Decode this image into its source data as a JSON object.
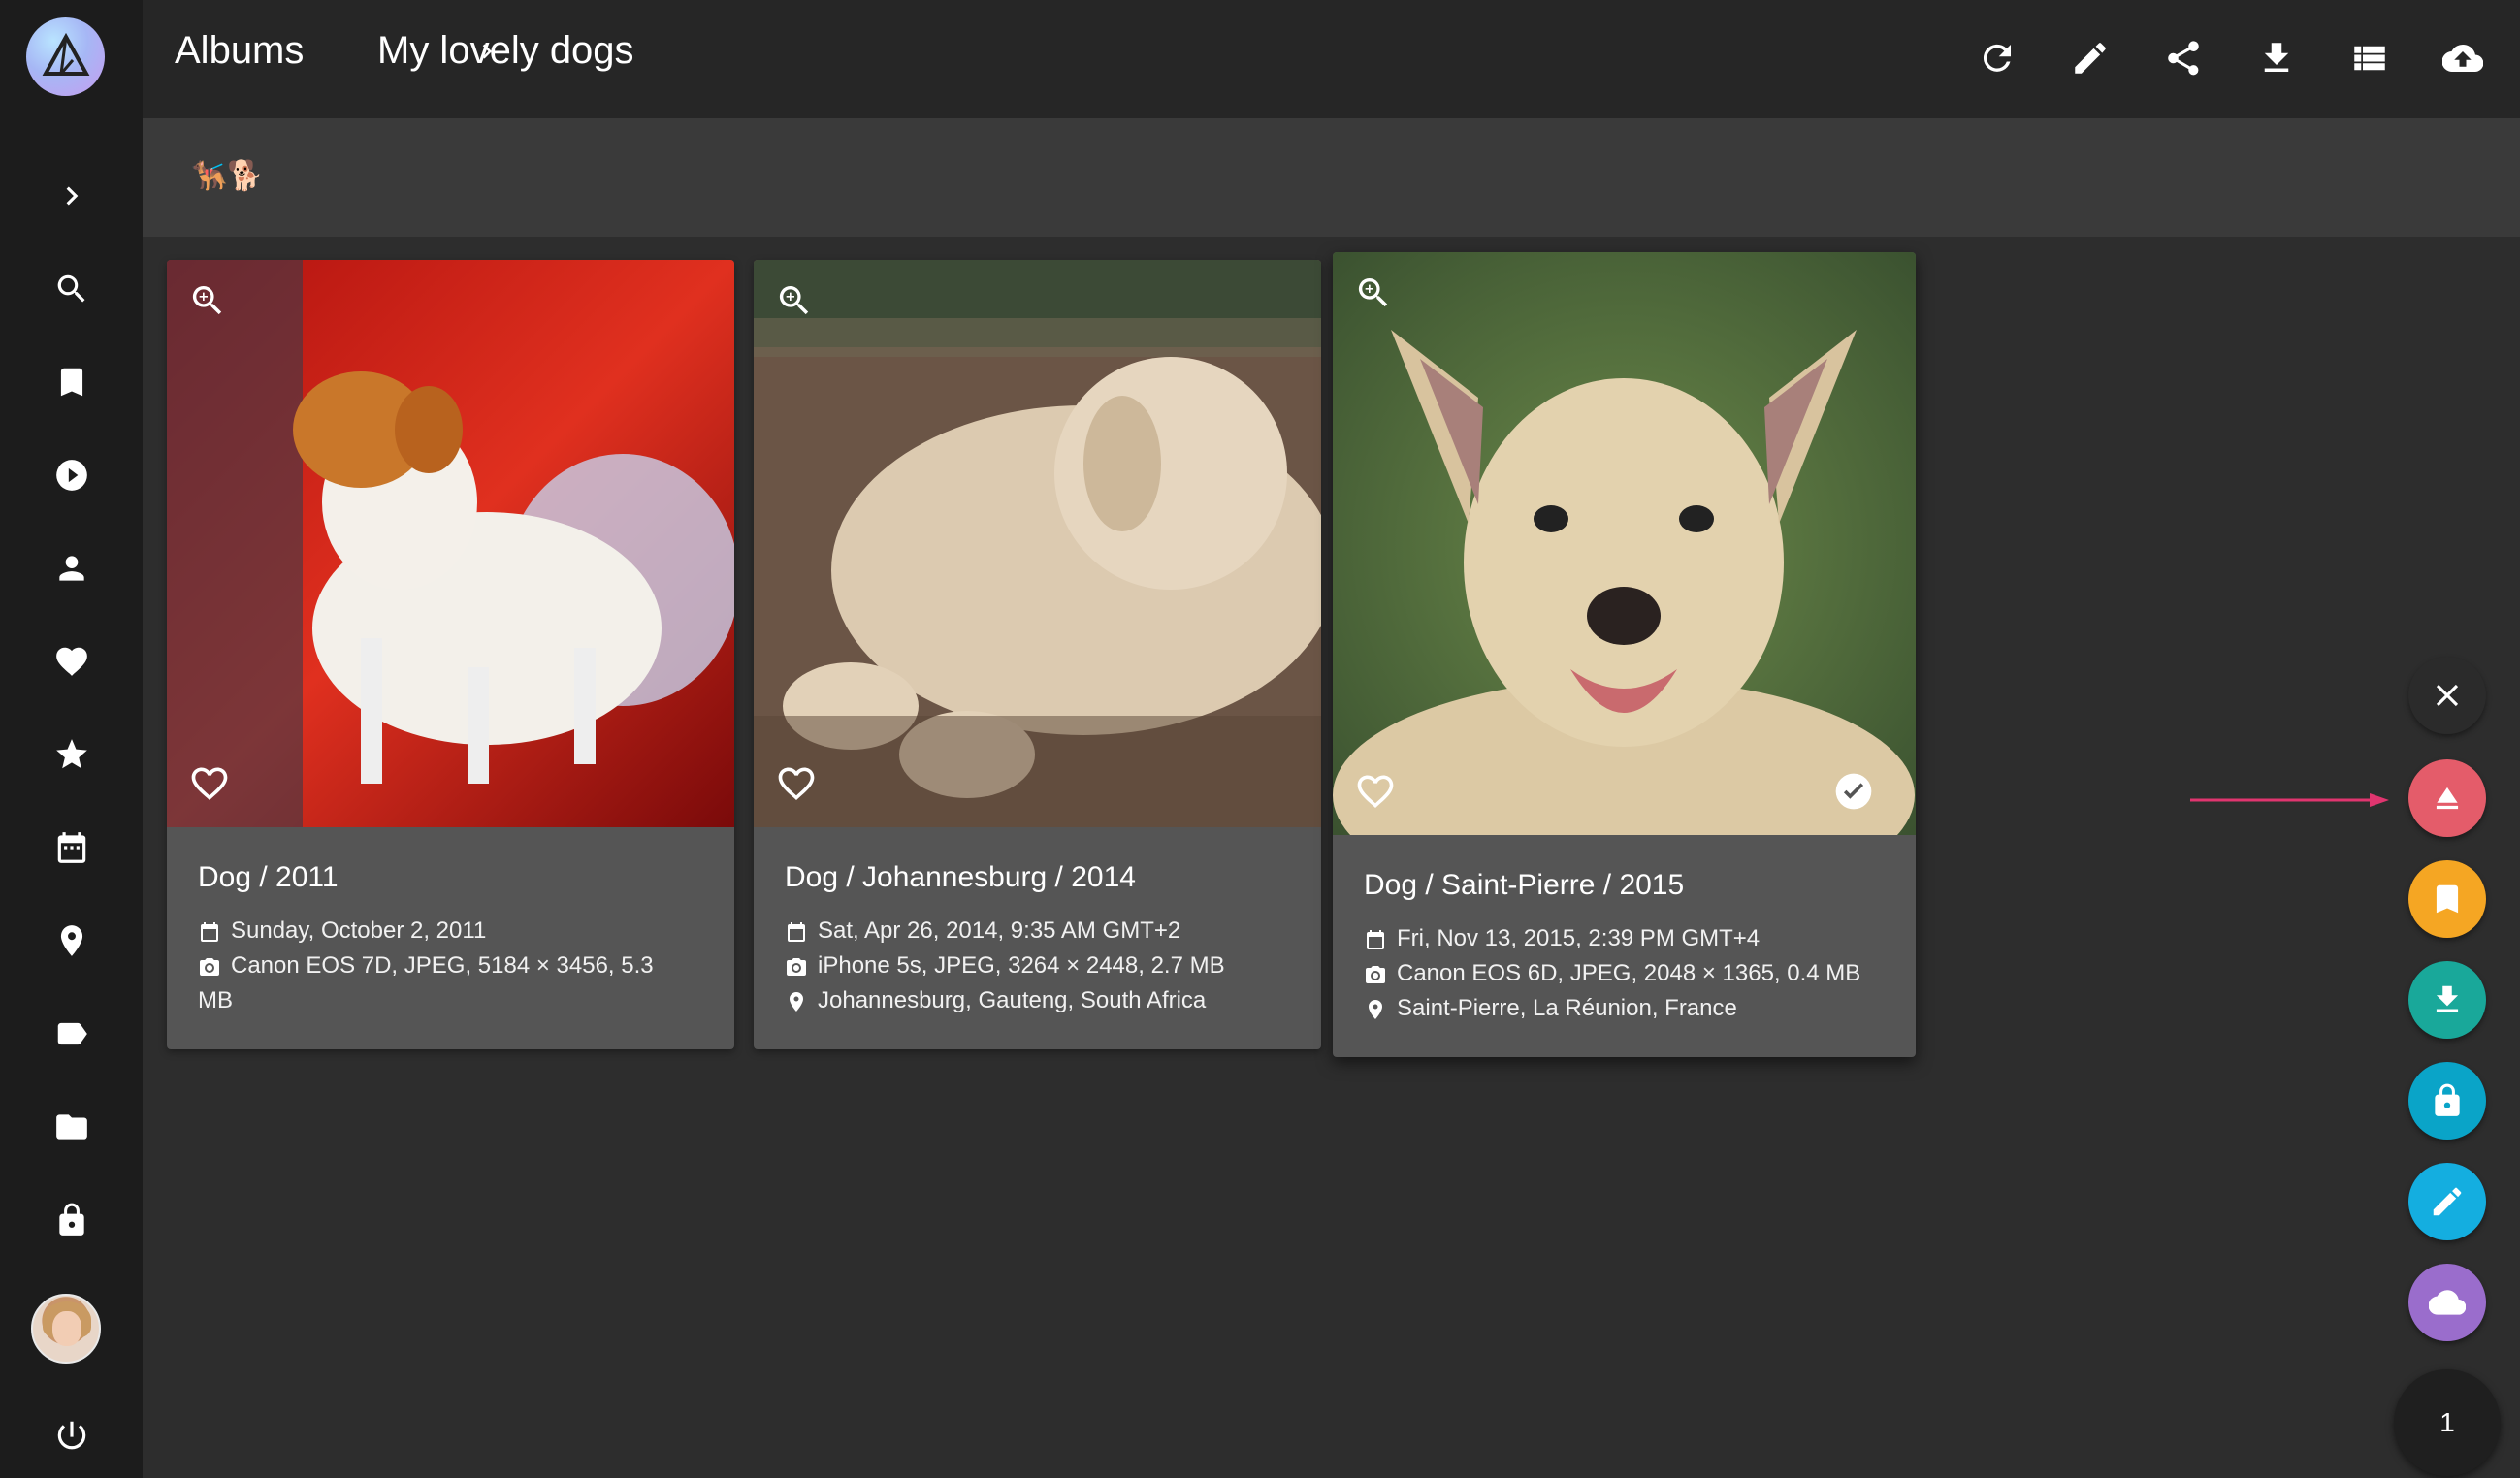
{
  "header": {
    "breadcrumb_root": "Albums",
    "breadcrumb_current": "My lovely dogs"
  },
  "toolbar": {
    "buttons": [
      "refresh-icon",
      "edit-icon",
      "share-icon",
      "download-icon",
      "list-view-icon",
      "upload-icon"
    ]
  },
  "album": {
    "description": "🐕‍🦺🐕"
  },
  "sidebar": {
    "items": [
      "expand-icon",
      "search-icon",
      "bookmark-icon",
      "play-icon",
      "person-icon",
      "heart-icon",
      "star-icon",
      "calendar-icon",
      "location-icon",
      "label-icon",
      "folder-icon",
      "lock-icon",
      "avatar",
      "power-icon"
    ]
  },
  "photos": [
    {
      "title": "Dog / 2011",
      "date": "Sunday, October 2, 2011",
      "camera": "Canon EOS 7D, JPEG, 5184 × 3456, 5.3",
      "camera_wrap": "MB",
      "location": "",
      "selected": false
    },
    {
      "title": "Dog / Johannesburg / 2014",
      "date": "Sat, Apr 26, 2014, 9:35 AM GMT+2",
      "camera": "iPhone 5s, JPEG, 3264 × 2448, 2.7 MB",
      "location": "Johannesburg, Gauteng, South Africa",
      "selected": false
    },
    {
      "title": "Dog / Saint-Pierre / 2015",
      "date": "Fri, Nov 13, 2015, 2:39 PM GMT+4",
      "camera": "Canon EOS 6D, JPEG, 2048 × 1365, 0.4 MB",
      "location": "Saint-Pierre, La Réunion, France",
      "selected": true
    }
  ],
  "clipboard": {
    "selected_count": "1",
    "actions": [
      {
        "icon": "close-icon",
        "color": "#2b2b2b"
      },
      {
        "icon": "eject-icon",
        "color": "#e45c6a"
      },
      {
        "icon": "bookmark-icon",
        "color": "#f5a623"
      },
      {
        "icon": "download-icon",
        "color": "#19a89a"
      },
      {
        "icon": "lock-icon",
        "color": "#0aa4c8"
      },
      {
        "icon": "edit-icon",
        "color": "#14aee0"
      },
      {
        "icon": "cloud-icon",
        "color": "#9a6dcc"
      }
    ]
  },
  "annotation": {
    "arrow_color": "#e0356f"
  }
}
